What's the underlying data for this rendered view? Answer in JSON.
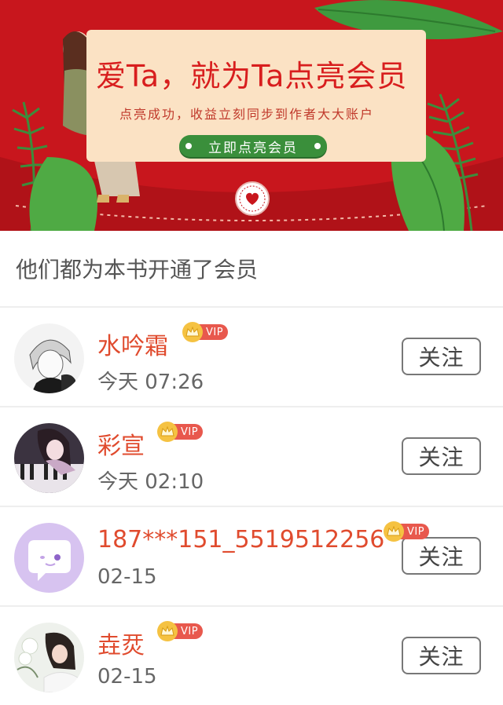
{
  "banner": {
    "title": "爱Ta，就为Ta点亮会员",
    "subtitle": "点亮成功，收益立刻同步到作者大大账户",
    "cta_label": "立即点亮会员"
  },
  "section_title": "他们都为本书开通了会员",
  "vip_label": "VIP",
  "follow_label": "关注",
  "colors": {
    "banner_red": "#c8161d",
    "accent_name": "#e04b2e",
    "vip_red": "#e8584d",
    "crown_gold": "#f5c242",
    "cta_green": "#3a8f3b"
  },
  "members": [
    {
      "name": "水吟霜",
      "time": "今天 07:26",
      "avatar_icon": "sketch-boy-avatar-icon"
    },
    {
      "name": "彩宣",
      "time": "今天 02:10",
      "avatar_icon": "piano-girl-avatar-icon"
    },
    {
      "name": "187***151_5519512256",
      "time": "02-15",
      "avatar_icon": "chat-bubble-avatar-icon"
    },
    {
      "name": "垚烎",
      "time": "02-15",
      "avatar_icon": "girl-with-flowers-avatar-icon"
    }
  ]
}
